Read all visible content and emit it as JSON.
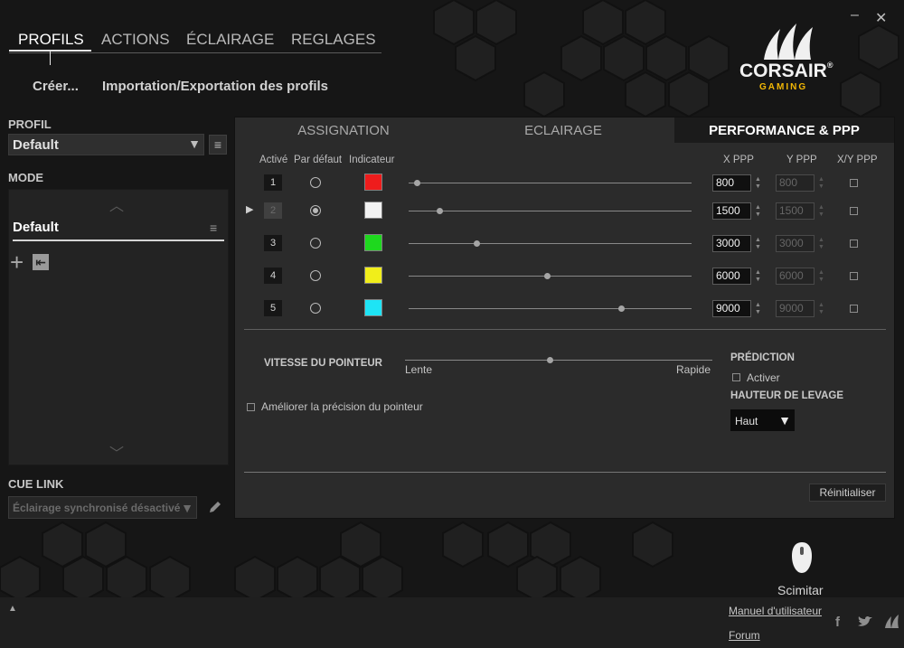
{
  "window": {
    "minimize_glyph": "–",
    "close_glyph": "✕"
  },
  "nav": {
    "tabs": [
      {
        "label": "PROFILS",
        "active": true
      },
      {
        "label": "ACTIONS",
        "active": false
      },
      {
        "label": "ÉCLAIRAGE",
        "active": false
      },
      {
        "label": "REGLAGES",
        "active": false
      }
    ],
    "sub": {
      "create": "Créer...",
      "import_export": "Importation/Exportation des profils"
    }
  },
  "logo": {
    "brand": "CORSAIR",
    "registered": "®",
    "sub": "GAMING",
    "sub_color": "#f2b705"
  },
  "profile": {
    "label": "PROFIL",
    "value": "Default",
    "arrow": "▼",
    "menu_glyph": "≡"
  },
  "mode": {
    "label": "MODE",
    "up_glyph": "︿",
    "down_glyph": "﹀",
    "selected": "Default",
    "menu_glyph": "≡",
    "add_glyph": "+",
    "assign_glyph": "⇤"
  },
  "cue_link": {
    "label": "CUE LINK",
    "value": "Éclairage synchronisé désactivé",
    "arrow": "▼",
    "edit_icon": "pencil-icon"
  },
  "panel_tabs": [
    {
      "label": "ASSIGNATION",
      "active": false
    },
    {
      "label": "ECLAIRAGE",
      "active": false
    },
    {
      "label": "PERFORMANCE & PPP",
      "active": true
    }
  ],
  "dpi_table": {
    "headers": {
      "active": "Activé",
      "default": "Par défaut",
      "indicator": "Indicateur",
      "x": "X PPP",
      "y": "Y PPP",
      "xy": "X/Y PPP"
    },
    "current_marker": "▶",
    "spin_up": "▲",
    "spin_down": "▼",
    "rows": [
      {
        "num": "1",
        "default": false,
        "color": "#ee1c1c",
        "x": "800",
        "y": "800",
        "current": false,
        "slider_fraction": 0.03
      },
      {
        "num": "2",
        "default": true,
        "color": "#f2f2f2",
        "x": "1500",
        "y": "1500",
        "current": true,
        "slider_fraction": 0.11
      },
      {
        "num": "3",
        "default": false,
        "color": "#1ed81e",
        "x": "3000",
        "y": "3000",
        "current": false,
        "slider_fraction": 0.24
      },
      {
        "num": "4",
        "default": false,
        "color": "#f1ee1a",
        "x": "6000",
        "y": "6000",
        "current": false,
        "slider_fraction": 0.49
      },
      {
        "num": "5",
        "default": false,
        "color": "#1ee4f5",
        "x": "9000",
        "y": "9000",
        "current": false,
        "slider_fraction": 0.75
      }
    ]
  },
  "pointer": {
    "speed_label": "VITESSE DU POINTEUR",
    "slow": "Lente",
    "fast": "Rapide",
    "speed_fraction": 0.47,
    "enhance_label": "Améliorer la précision du pointeur"
  },
  "prediction": {
    "title": "PRÉDICTION",
    "activate": "Activer"
  },
  "lift_height": {
    "title": "HAUTEUR DE LEVAGE",
    "value": "Haut",
    "arrow": "▼"
  },
  "reset_label": "Réinitialiser",
  "device": {
    "name": "Scimitar"
  },
  "footer": {
    "collapse_glyph": "▲",
    "manual": "Manuel d'utilisateur",
    "forum": "Forum",
    "facebook": "f",
    "twitter": "twitter-icon",
    "corsair": "corsair-sails-icon"
  }
}
